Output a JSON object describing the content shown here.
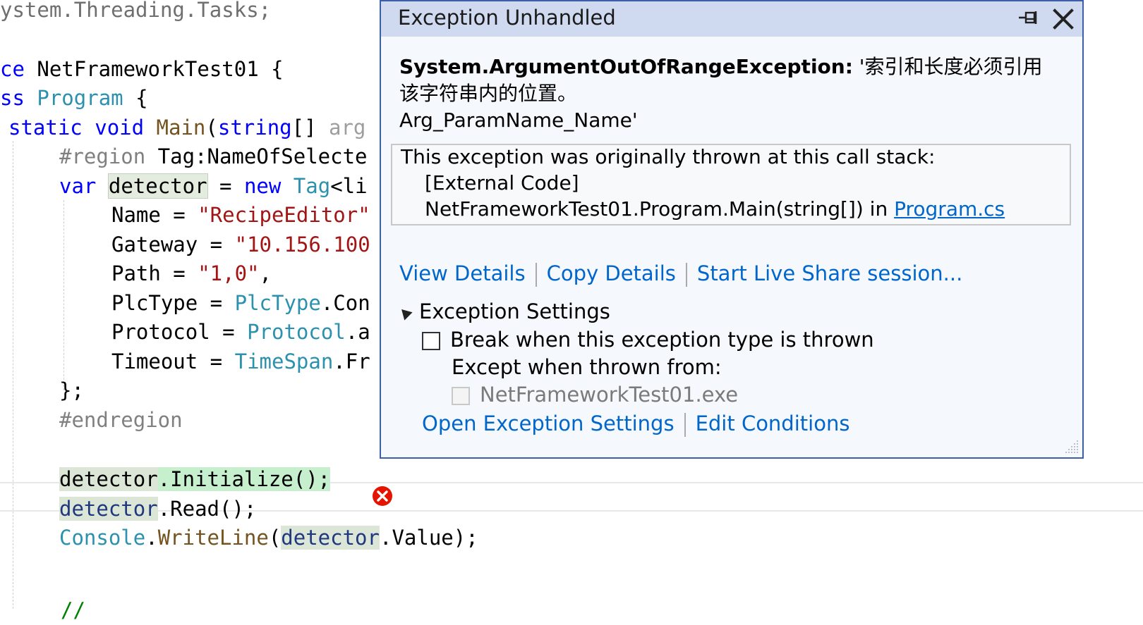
{
  "code": {
    "line1": "ystem.Threading.Tasks;",
    "line3_kw": "ce",
    "line3_name": " NetFrameworkTest01 {",
    "line4_kw": "ss",
    "line4_type": "Program",
    "line4_rest": " {",
    "line5_kw1": "static",
    "line5_kw2": "void",
    "line5_method": "Main",
    "line5_kw3": "string",
    "line5_rest": "[] ",
    "line5_dim": "arg",
    "region": "#region",
    "region_name": " Tag:NameOfSelecte",
    "var_kw": "var",
    "detector": "detector",
    "eq_new": " = ",
    "new_kw": "new",
    "tag_type": "Tag",
    "tag_rest": "<li",
    "name_prop": "Name = ",
    "name_val": "\"RecipeEditor\"",
    "gateway_prop": "Gateway = ",
    "gateway_val": "\"10.156.100",
    "path_prop": "Path = ",
    "path_val": "\"1,0\"",
    "path_comma": ",",
    "plctype_prop": "PlcType = ",
    "plctype_type": "PlcType",
    "plctype_rest": ".Con",
    "protocol_prop": "Protocol = ",
    "protocol_type": "Protocol",
    "protocol_rest": ".a",
    "timeout_prop": "Timeout = ",
    "timeout_type": "TimeSpan",
    "timeout_rest": ".Fr",
    "close_brace": "};",
    "endregion": "#endregion",
    "init_obj": "detector",
    "init_rest": ".Initialize();",
    "read_obj": "detector",
    "read_rest": ".Read();",
    "console_type": "Console",
    "console_dot": ".",
    "writeline": "WriteLine",
    "wl_paren": "(",
    "wl_obj": "detector",
    "wl_rest": ".Value);",
    "comment_partial": "//"
  },
  "popup": {
    "title": "Exception Unhandled",
    "exception_type": "System.ArgumentOutOfRangeException:",
    "exception_msg_1": " '索引和长度必须引用",
    "exception_msg_2": "该字符串内的位置。",
    "exception_msg_3": "Arg_ParamName_Name'",
    "stack_header": "This exception was originally thrown at this call stack:",
    "stack_frame_1": "[External Code]",
    "stack_frame_2": "NetFrameworkTest01.Program.Main(string[]) in ",
    "stack_frame_2_link": "Program.cs",
    "view_details": "View Details",
    "copy_details": "Copy Details",
    "live_share": "Start Live Share session...",
    "settings_title": "Exception Settings",
    "break_label": "Break when this exception type is thrown",
    "except_label": "Except when thrown from:",
    "exe_label": "NetFrameworkTest01.exe",
    "open_settings": "Open Exception Settings",
    "edit_conditions": "Edit Conditions"
  },
  "icons": {
    "pin": "pin-icon",
    "close": "close-icon",
    "error": "error-icon",
    "collapse": "triangle-icon",
    "grip": "resize-grip-icon"
  },
  "colors": {
    "keyword": "#0000ff",
    "type": "#2b91af",
    "string": "#a31515",
    "link": "#0066cc",
    "popup_border": "#3c5fa8",
    "popup_header": "#cfd9ef",
    "error_red": "#e51400"
  }
}
